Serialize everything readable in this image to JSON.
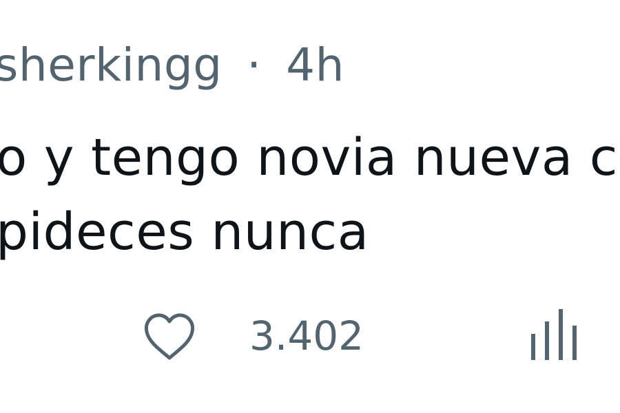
{
  "post": {
    "header": {
      "username": "sherkingg",
      "separator": "·",
      "time": "4h"
    },
    "text_lines": [
      "o y tengo novia nueva che",
      "pideces nunca"
    ],
    "actions": {
      "like_icon": "heart-icon",
      "like_count": "3.402",
      "stats_icon": "bar-chart-icon"
    }
  }
}
